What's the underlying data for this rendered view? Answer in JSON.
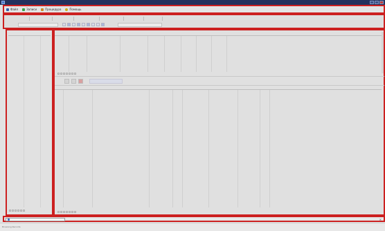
{
  "window": {
    "title": ""
  },
  "menu": {
    "items": [
      {
        "label": "Файл",
        "icon": "file-icon"
      },
      {
        "label": "Записи",
        "icon": "entries-icon"
      },
      {
        "label": "Процедура",
        "icon": "procedure-icon"
      },
      {
        "label": "Помощь",
        "icon": "help-icon"
      }
    ]
  },
  "ribbon": {
    "tabs": [
      "",
      "",
      "",
      "",
      "",
      "",
      ""
    ],
    "filter_label": "",
    "search_label": ""
  },
  "side_panel": {
    "columns": [
      "",
      ""
    ]
  },
  "master_grid": {
    "columns": [
      "",
      "",
      "",
      "",
      "",
      "",
      "",
      "",
      "",
      ""
    ]
  },
  "detail": {
    "button_label": "",
    "columns": [
      "",
      "",
      "",
      "",
      "",
      "",
      "",
      "",
      "",
      ""
    ]
  },
  "taskbar": {
    "tab_label": ""
  },
  "status": {
    "text": "Browsing Records"
  },
  "colors": {
    "frame": "#cc2020",
    "title_bar": "#23325e"
  }
}
